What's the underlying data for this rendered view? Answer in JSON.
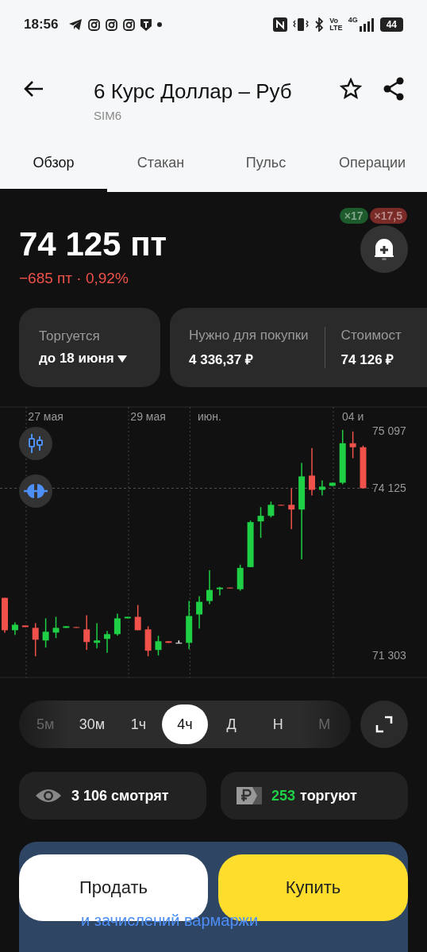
{
  "status_bar": {
    "time": "18:56",
    "network": "4G",
    "volte": [
      "Vo",
      "LTE"
    ],
    "battery": "44"
  },
  "header": {
    "title": "6 Курс Доллар – Руб",
    "subtitle": "SIM6",
    "favorite": false
  },
  "tabs": [
    {
      "label": "Обзор",
      "selected": true
    },
    {
      "label": "Стакан",
      "selected": false
    },
    {
      "label": "Пульс",
      "selected": false
    },
    {
      "label": "Операции",
      "selected": false
    }
  ],
  "leverage": [
    {
      "label": "×17",
      "color": "#1d5b2c"
    },
    {
      "label": "×17,5",
      "color": "#7a2a27"
    }
  ],
  "price": {
    "value": "74 125 пт",
    "change": "−685 пт · 0,92%"
  },
  "expiry": {
    "label": "Торгуется",
    "value": "до 18 июня"
  },
  "costs": [
    {
      "label": "Нужно для покупки",
      "value": "4 336,37 ₽"
    },
    {
      "label": "Стоимост",
      "value": "74 126 ₽"
    }
  ],
  "chart": {
    "chart_data": {
      "type": "candlestick",
      "categories": [
        null,
        null,
        null,
        null,
        "27 мая",
        null,
        null,
        null,
        null,
        null,
        null,
        null,
        null,
        null,
        "29 мая",
        null,
        null,
        null,
        null,
        null,
        "июн.",
        null,
        null,
        null,
        null,
        null,
        null,
        null,
        null,
        null,
        null,
        null,
        null,
        null,
        "04 и",
        null
      ],
      "ohlc": [
        [
          72275,
          72275,
          71689,
          71729
        ],
        [
          71729,
          71862,
          71649,
          71822
        ],
        [
          71809,
          71809,
          71782,
          71782
        ],
        [
          71769,
          71849,
          71289,
          71569
        ],
        [
          71556,
          71929,
          71436,
          71703
        ],
        [
          71689,
          71955,
          71596,
          71769
        ],
        [
          71769,
          71796,
          71769,
          71796
        ],
        [
          71782,
          71782,
          71769,
          71769
        ],
        [
          71743,
          71982,
          71396,
          71530
        ],
        [
          71516,
          71849,
          71423,
          71556
        ],
        [
          71583,
          71716,
          71349,
          71663
        ],
        [
          71663,
          72009,
          71636,
          71929
        ],
        [
          71929,
          71955,
          71929,
          71955
        ],
        [
          71955,
          72155,
          71729,
          71729
        ],
        [
          71743,
          71796,
          71289,
          71383
        ],
        [
          71396,
          71636,
          71303,
          71543
        ],
        [
          71543,
          71543,
          71516,
          71516
        ],
        [
          71516,
          71556,
          71516,
          71516
        ],
        [
          71516,
          72222,
          71410,
          71969
        ],
        [
          71995,
          72302,
          71756,
          72208
        ],
        [
          72222,
          72741,
          72168,
          72408
        ],
        [
          72421,
          72461,
          72315,
          72448
        ],
        [
          72448,
          72448,
          72435,
          72435
        ],
        [
          72421,
          72834,
          72395,
          72781
        ],
        [
          72794,
          73579,
          72794,
          73553
        ],
        [
          73566,
          73806,
          73286,
          73659
        ],
        [
          73659,
          73899,
          73633,
          73845
        ],
        [
          73845,
          73845,
          73832,
          73832
        ],
        [
          73845,
          74125,
          73433,
          73766
        ],
        [
          73766,
          74551,
          72927,
          74325
        ],
        [
          74338,
          74804,
          74005,
          74098
        ],
        [
          74098,
          74258,
          74005,
          74152
        ],
        [
          74165,
          74218,
          74165,
          74218
        ],
        [
          74218,
          75110,
          74192,
          74884
        ],
        [
          74884,
          75083,
          74631,
          74817
        ],
        [
          74817,
          74844,
          74125,
          74125
        ]
      ],
      "ylim": [
        70931,
        75496
      ],
      "ref_lines": [
        {
          "axis": "y",
          "value": 74125
        }
      ],
      "grid": true,
      "yticks": [
        {
          "value": 75097,
          "label": "75 097"
        },
        {
          "value": 74125,
          "label": "74 125"
        },
        {
          "value": 71303,
          "label": "71 303"
        }
      ]
    }
  },
  "timeframes": [
    {
      "label": "5м",
      "selected": false
    },
    {
      "label": "30м",
      "selected": false
    },
    {
      "label": "1ч",
      "selected": false
    },
    {
      "label": "4ч",
      "selected": true
    },
    {
      "label": "Д",
      "selected": false
    },
    {
      "label": "Н",
      "selected": false
    },
    {
      "label": "М",
      "selected": false
    }
  ],
  "watchers": "3 106 смотрят",
  "traders": {
    "count": "253",
    "label": "торгуют"
  },
  "banner": "и зачислений вармаржи",
  "actions": {
    "sell": "Продать",
    "buy": "Купить"
  }
}
